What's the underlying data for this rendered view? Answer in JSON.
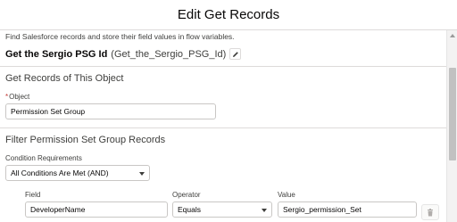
{
  "modal": {
    "title": "Edit Get Records"
  },
  "intro_text": "Find Salesforce records and store their field values in flow variables.",
  "element": {
    "label": "Get the Sergio PSG Id",
    "api_name": "(Get_the_Sergio_PSG_Id)"
  },
  "get_records_section": {
    "title": "Get Records of This Object",
    "object_label": "Object",
    "object_value": "Permission Set Group"
  },
  "filter_section": {
    "title": "Filter Permission Set Group Records",
    "condition_requirements_label": "Condition Requirements",
    "condition_requirements_value": "All Conditions Are Met (AND)",
    "columns": {
      "field": "Field",
      "operator": "Operator",
      "value": "Value"
    },
    "rows": [
      {
        "field": "DeveloperName",
        "operator": "Equals",
        "value": "Sergio_permission_Set"
      }
    ]
  },
  "icons": {
    "edit": "pencil-icon",
    "delete": "trash-icon",
    "dropdown": "chevron-down-icon"
  }
}
